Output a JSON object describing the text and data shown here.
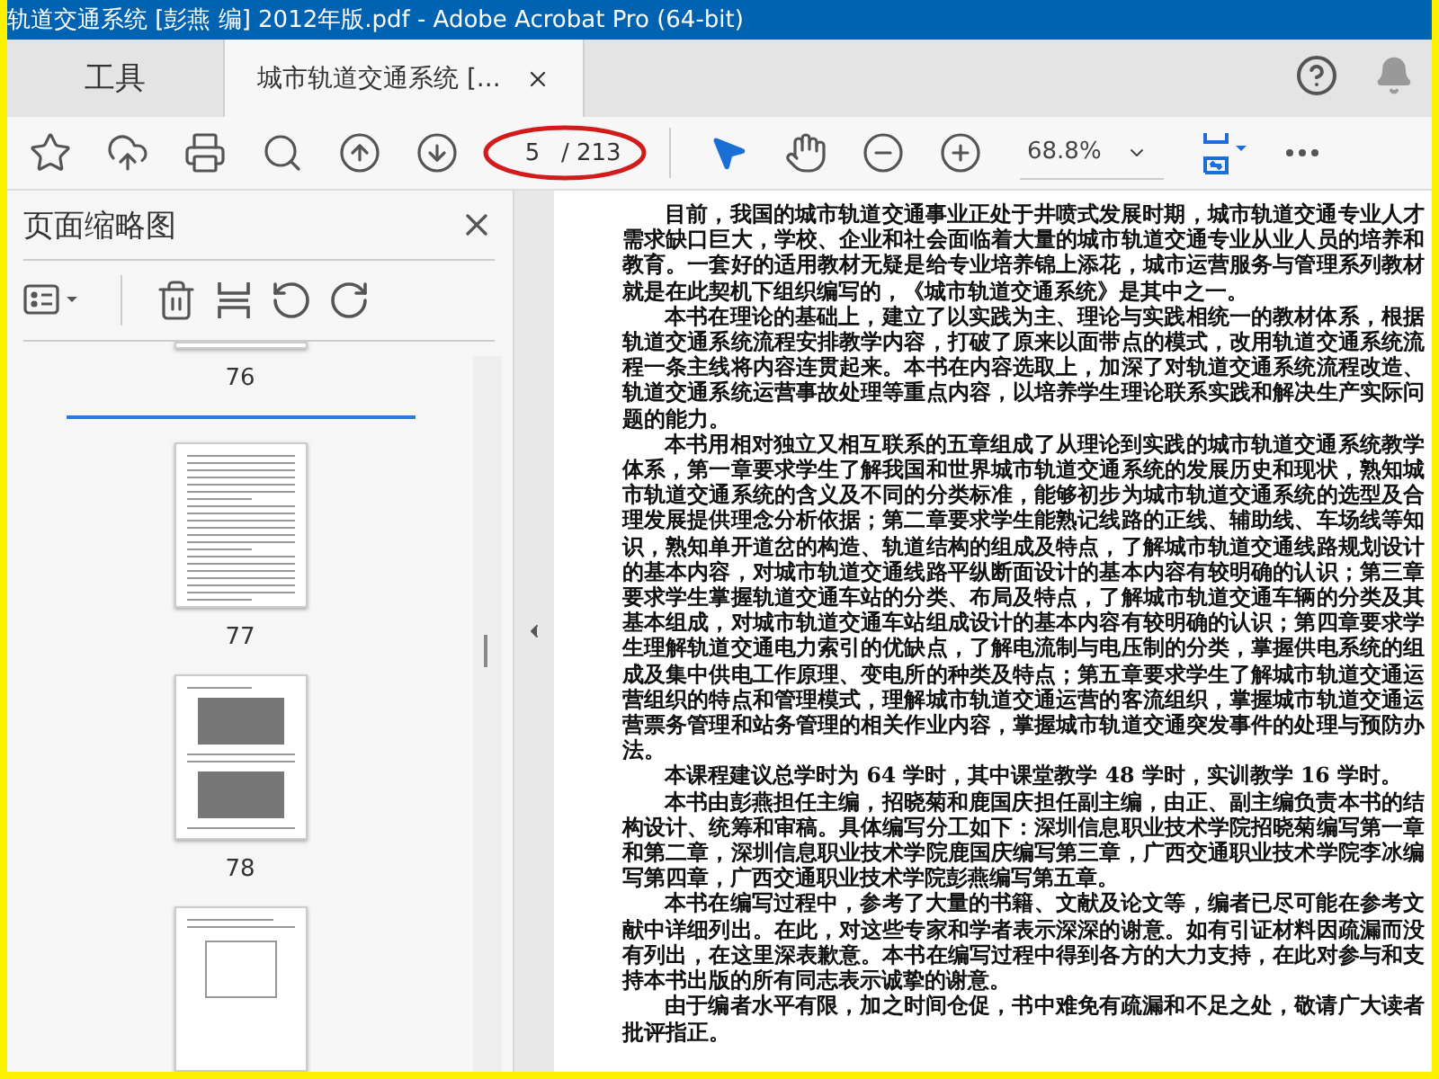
{
  "window": {
    "title": "轨道交通系统 [彭燕 编] 2012年版.pdf - Adobe Acrobat Pro (64-bit)"
  },
  "tabs": [
    {
      "label": "工具",
      "kind": "home",
      "selected": false
    },
    {
      "label": "城市轨道交通系统 [...",
      "kind": "document",
      "selected": true
    }
  ],
  "toolbar": {
    "page_number": "5",
    "page_total": "/ 213",
    "zoom": "68.8%"
  },
  "thumbnail_panel": {
    "title": "页面缩略图",
    "pages": [
      {
        "label": "76",
        "kind": "cut"
      },
      {
        "label": "77",
        "kind": "text"
      },
      {
        "label": "78",
        "kind": "photos"
      },
      {
        "kind": "diagram"
      }
    ]
  },
  "document": {
    "paragraphs": [
      "目前，我国的城市轨道交通事业正处于井喷式发展时期，城市轨道交通专业人才需求缺口巨大，学校、企业和社会面临着大量的城市轨道交通专业从业人员的培养和教育。一套好的适用教材无疑是给专业培养锦上添花，城市运营服务与管理系列教材就是在此契机下组织编写的，《城市轨道交通系统》是其中之一。",
      "本书在理论的基础上，建立了以实践为主、理论与实践相统一的教材体系，根据轨道交通系统流程安排教学内容，打破了原来以面带点的模式，改用轨道交通系统流程一条主线将内容连贯起来。本书在内容选取上，加深了对轨道交通系统流程改造、轨道交通系统运营事故处理等重点内容，以培养学生理论联系实践和解决生产实际问题的能力。",
      "本书用相对独立又相互联系的五章组成了从理论到实践的城市轨道交通系统教学体系，第一章要求学生了解我国和世界城市轨道交通系统的发展历史和现状，熟知城市轨道交通系统的含义及不同的分类标准，能够初步为城市轨道交通系统的选型及合理发展提供理念分析依据；第二章要求学生能熟记线路的正线、辅助线、车场线等知识，熟知单开道岔的构造、轨道结构的组成及特点，了解城市轨道交通线路规划设计的基本内容，对城市轨道交通线路平纵断面设计的基本内容有较明确的认识；第三章要求学生掌握轨道交通车站的分类、布局及特点，了解城市轨道交通车辆的分类及其基本组成，对城市轨道交通车站组成设计的基本内容有较明确的认识；第四章要求学生理解轨道交通电力索引的优缺点，了解电流制与电压制的分类，掌握供电系统的组成及集中供电工作原理、变电所的种类及特点；第五章要求学生了解城市轨道交通运营组织的特点和管理模式，理解城市轨道交通运营的客流组织，掌握城市轨道交通运营票务管理和站务管理的相关作业内容，掌握城市轨道交通突发事件的处理与预防办法。",
      "本课程建议总学时为 64 学时，其中课堂教学 48 学时，实训教学 16 学时。",
      "本书由彭燕担任主编，招晓菊和鹿国庆担任副主编，由正、副主编负责本书的结构设计、统筹和审稿。具体编写分工如下：深圳信息职业技术学院招晓菊编写第一章和第二章，深圳信息职业技术学院鹿国庆编写第三章，广西交通职业技术学院李冰编写第四章，广西交通职业技术学院彭燕编写第五章。",
      "本书在编写过程中，参考了大量的书籍、文献及论文等，编者已尽可能在参考文献中详细列出。在此，对这些专家和学者表示深深的谢意。如有引证材料因疏漏而没有列出，在这里深表歉意。本书在编写过程中得到各方的大力支持，在此对参与和支持本书出版的所有同志表示诚挚的谢意。",
      "由于编者水平有限，加之时间仓促，书中难免有疏漏和不足之处，敬请广大读者批评指正。"
    ]
  }
}
